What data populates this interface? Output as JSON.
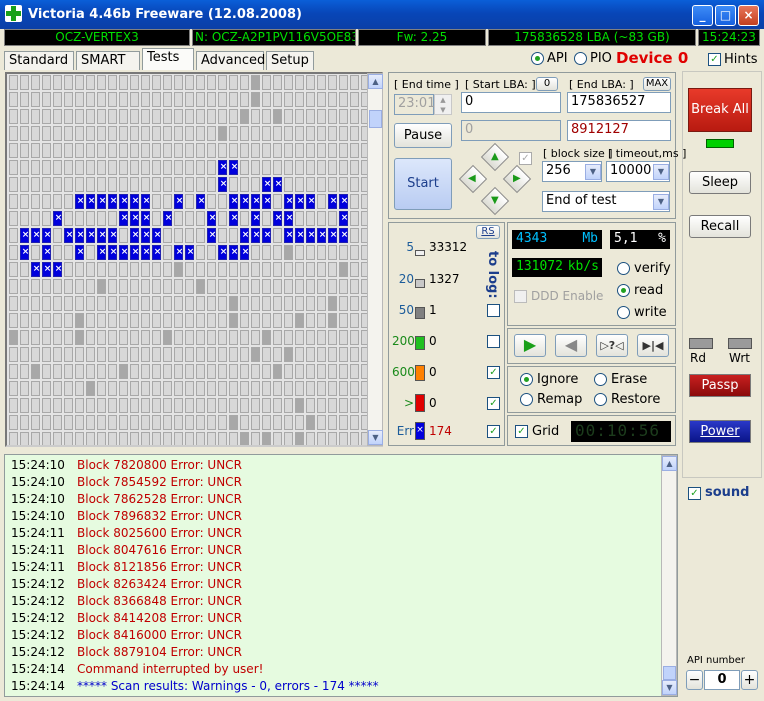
{
  "window": {
    "title": "Victoria 4.46b Freeware (12.08.2008)",
    "min": "_",
    "max": "□",
    "close": "×"
  },
  "infobar": {
    "model": "OCZ-VERTEX3",
    "serial": "N: OCZ-A2P1PV116V5OE836",
    "firmware": "Fw: 2.25",
    "capacity": "175836528 LBA (~83 GB)",
    "time": "15:24:23"
  },
  "tabs": [
    "Standard",
    "SMART",
    "Tests",
    "Advanced",
    "Setup"
  ],
  "mode": {
    "api": "API",
    "pio": "PIO",
    "device": "Device 0",
    "hints": "Hints"
  },
  "test": {
    "end_time_label": "[ End time ]",
    "end_time": "23:01",
    "start_lba_label": "[ Start LBA: ]",
    "start_lba_zero": "0",
    "start_lba": "0",
    "start_lba_dis": "0",
    "end_lba_label": "[ End LBA: ]",
    "end_lba_max": "MAX",
    "end_lba": "175836527",
    "end_lba2": "8912127",
    "pause": "Pause",
    "start": "Start",
    "block_size_label": "[ block size ]",
    "block_size": "256",
    "timeout_label": "[ timeout,ms ]",
    "timeout": "10000",
    "end_action": "End of test"
  },
  "stats": {
    "rs": "RS",
    "to_log": "to log:",
    "rows": [
      {
        "label": "5",
        "count": "33312"
      },
      {
        "label": "20",
        "count": "1327"
      },
      {
        "label": "50",
        "count": "1"
      },
      {
        "label": "200",
        "count": "0"
      },
      {
        "label": "600",
        "count": "0"
      },
      {
        "label": ">",
        "count": "0"
      },
      {
        "label": "Err",
        "count": "174"
      }
    ]
  },
  "perf": {
    "mb": "4343",
    "mb_unit": "Mb",
    "percent": "5,1",
    "percent_unit": "%",
    "speed": "131072",
    "speed_unit": "kb/s",
    "ddd": "DDD Enable"
  },
  "modes": {
    "verify": "verify",
    "read": "read",
    "write": "write"
  },
  "actions": {
    "ignore": "Ignore",
    "erase": "Erase",
    "remap": "Remap",
    "restore": "Restore",
    "grid": "Grid",
    "timer": "00:10:56"
  },
  "right": {
    "break_all": "Break All",
    "sleep": "Sleep",
    "recall": "Recall",
    "rd": "Rd",
    "wrt": "Wrt",
    "passp": "Passp",
    "power": "Power",
    "sound": "sound",
    "api_number_label": "API number",
    "api_number": "0",
    "minus": "−",
    "plus": "+"
  },
  "log": [
    {
      "time": "15:24:10",
      "msg": "Block 7820800 Error: UNCR",
      "type": "err"
    },
    {
      "time": "15:24:10",
      "msg": "Block 7854592 Error: UNCR",
      "type": "err"
    },
    {
      "time": "15:24:10",
      "msg": "Block 7862528 Error: UNCR",
      "type": "err"
    },
    {
      "time": "15:24:10",
      "msg": "Block 7896832 Error: UNCR",
      "type": "err"
    },
    {
      "time": "15:24:11",
      "msg": "Block 8025600 Error: UNCR",
      "type": "err"
    },
    {
      "time": "15:24:11",
      "msg": "Block 8047616 Error: UNCR",
      "type": "err"
    },
    {
      "time": "15:24:11",
      "msg": "Block 8121856 Error: UNCR",
      "type": "err"
    },
    {
      "time": "15:24:12",
      "msg": "Block 8263424 Error: UNCR",
      "type": "err"
    },
    {
      "time": "15:24:12",
      "msg": "Block 8366848 Error: UNCR",
      "type": "err"
    },
    {
      "time": "15:24:12",
      "msg": "Block 8414208 Error: UNCR",
      "type": "err"
    },
    {
      "time": "15:24:12",
      "msg": "Block 8416000 Error: UNCR",
      "type": "err"
    },
    {
      "time": "15:24:12",
      "msg": "Block 8879104 Error: UNCR",
      "type": "err"
    },
    {
      "time": "15:24:14",
      "msg": "Command interrupted by user!",
      "type": "err"
    },
    {
      "time": "15:24:14",
      "msg": "***** Scan results: Warnings - 0, errors - 174 *****",
      "type": "info"
    }
  ],
  "colors": {
    "title_bar": "#0846b8",
    "info_text": "#00e000",
    "error_text": "#c00000",
    "info_log_text": "#0000cc",
    "error_block": "#0000dd"
  }
}
